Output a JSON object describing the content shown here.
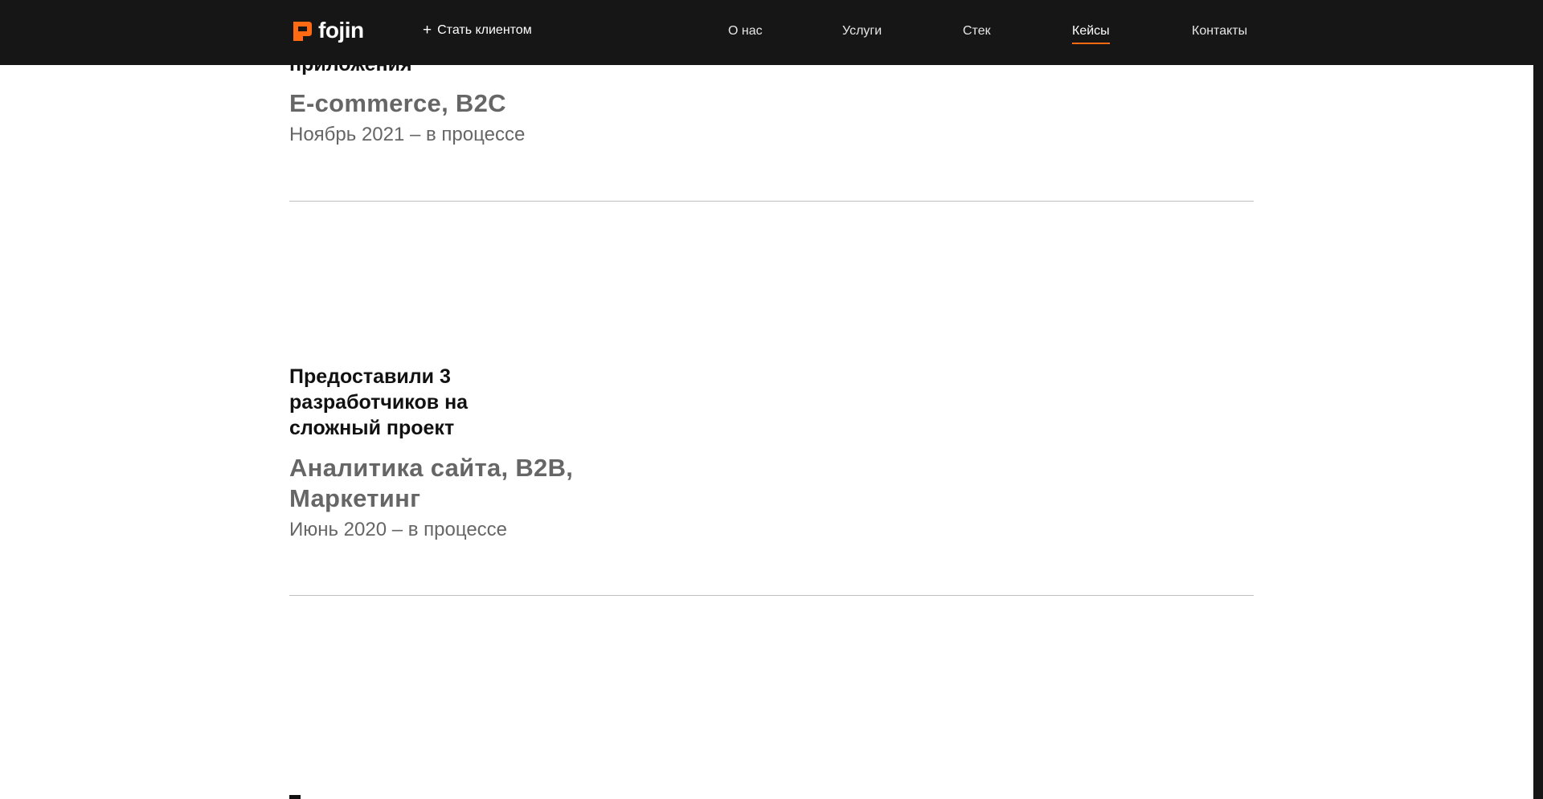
{
  "header": {
    "logo_text": "fojin",
    "cta_label": "Стать клиентом",
    "nav": [
      {
        "label": "О нас"
      },
      {
        "label": "Услуги"
      },
      {
        "label": "Стек"
      },
      {
        "label": "Кейсы",
        "active": true
      },
      {
        "label": "Контакты"
      }
    ],
    "accent_color": "#ff6a13",
    "background_color": "#161616"
  },
  "cases": [
    {
      "title": "приложения",
      "tags": "E-commerce, B2C",
      "dates": "Ноябрь 2021 – в процессе"
    },
    {
      "title_lines": [
        "Предоставили 3",
        "разработчиков на",
        "сложный проект"
      ],
      "tags_lines": [
        "Аналитика сайта, B2B,",
        "Маркетинг"
      ],
      "dates": "Июнь 2020 – в процессе"
    }
  ]
}
